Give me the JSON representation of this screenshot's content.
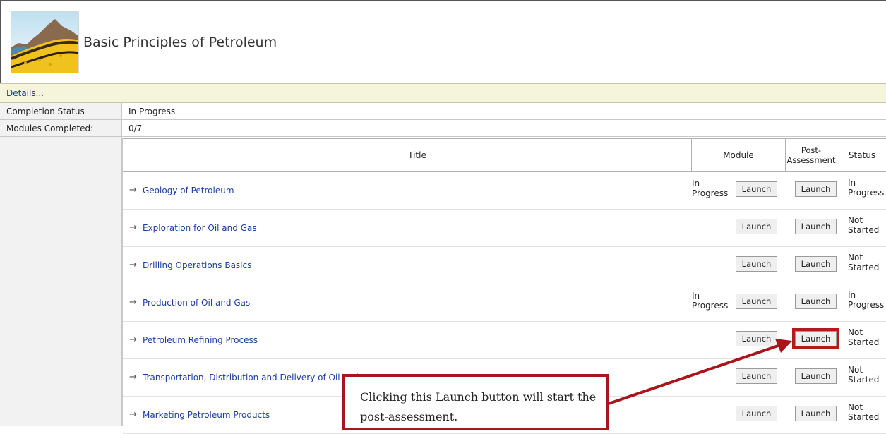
{
  "course": {
    "title": "Basic Principles of Petroleum",
    "thumbnail_icon": "geology-cross-section-icon"
  },
  "details": {
    "link_label": "Details..."
  },
  "info": [
    {
      "label": "Completion Status",
      "value": "In Progress"
    },
    {
      "label": "Modules Completed:",
      "value": "0/7"
    }
  ],
  "table": {
    "headers": {
      "title": "Title",
      "module": "Module",
      "post_assessment": "Post-\nAssessment",
      "status": "Status"
    },
    "rows": [
      {
        "arrow": "→",
        "title": "Geology of Petroleum",
        "module_status": "In\nProgress",
        "module_button": "Launch",
        "post_button": "Launch",
        "status": "In\nProgress"
      },
      {
        "arrow": "→",
        "title": "Exploration for Oil and Gas",
        "module_status": "",
        "module_button": "Launch",
        "post_button": "Launch",
        "status": "Not\nStarted"
      },
      {
        "arrow": "→",
        "title": "Drilling Operations Basics",
        "module_status": "",
        "module_button": "Launch",
        "post_button": "Launch",
        "status": "Not\nStarted"
      },
      {
        "arrow": "→",
        "title": "Production of Oil and Gas",
        "module_status": "In\nProgress",
        "module_button": "Launch",
        "post_button": "Launch",
        "status": "In\nProgress"
      },
      {
        "arrow": "→",
        "title": "Petroleum Refining Process",
        "module_status": "",
        "module_button": "Launch",
        "post_button": "Launch",
        "status": "Not\nStarted"
      },
      {
        "arrow": "→",
        "title": "Transportation, Distribution and Delivery of Oil and Gas",
        "module_status": "",
        "module_button": "Launch",
        "post_button": "Launch",
        "status": "Not\nStarted"
      },
      {
        "arrow": "→",
        "title": "Marketing Petroleum Products",
        "module_status": "",
        "module_button": "Launch",
        "post_button": "Launch",
        "status": "Not\nStarted"
      }
    ]
  },
  "callout": {
    "text": "Clicking this Launch button will start the post-assessment.",
    "color": "#a8151b"
  },
  "colors": {
    "link": "#1c3d9e",
    "details_bar": "#f5f5dc",
    "highlight": "#b51a1a"
  }
}
